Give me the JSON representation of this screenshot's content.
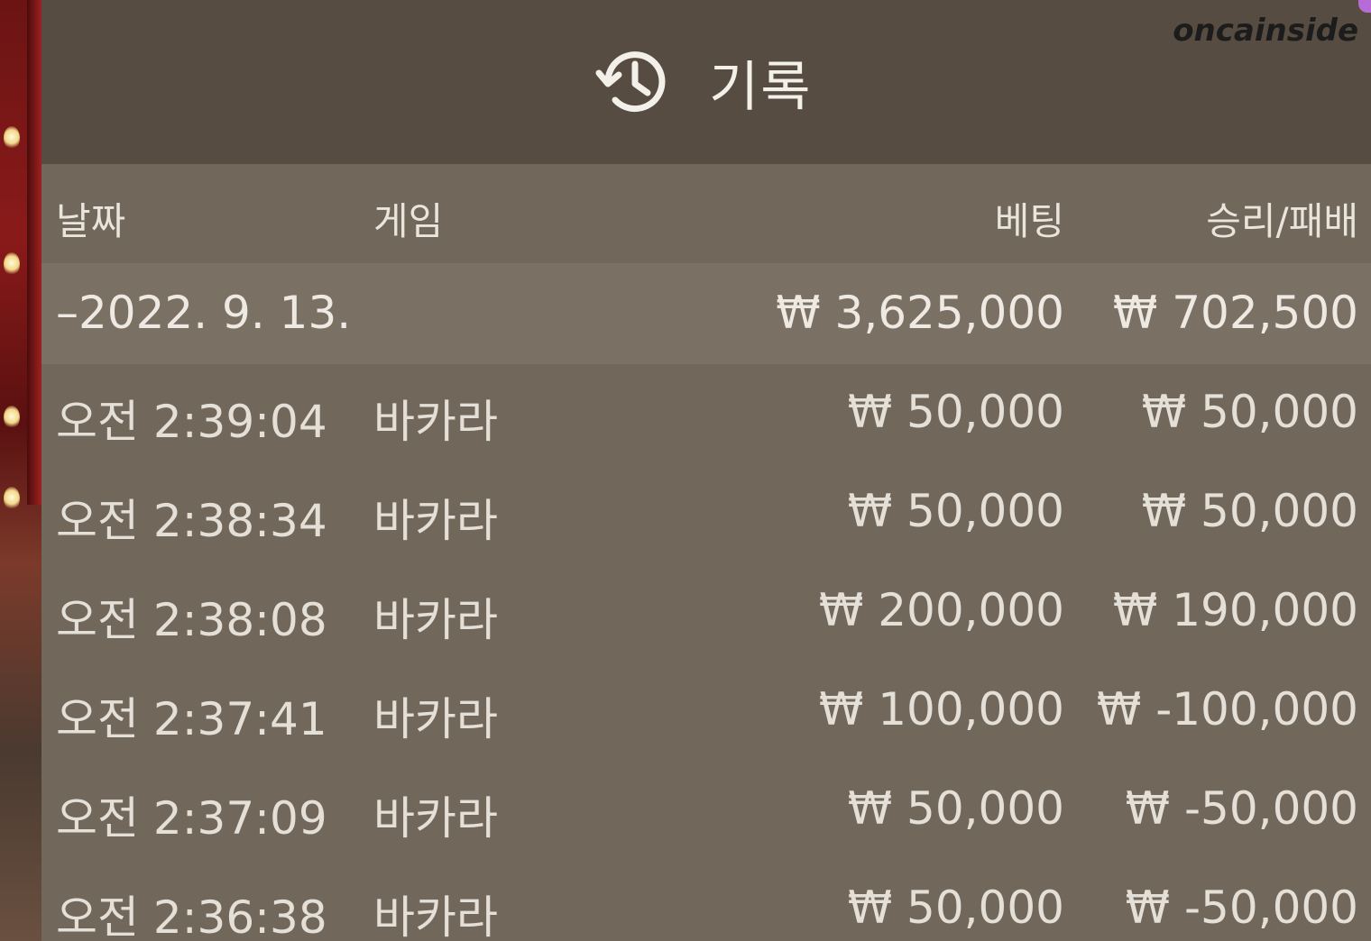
{
  "header": {
    "title": "기록",
    "icon": "history-icon",
    "watermark": "oncainside"
  },
  "table": {
    "columns": {
      "date": "날짜",
      "game": "게임",
      "bet": "베팅",
      "result": "승리/패배"
    },
    "summary": {
      "date": "–2022. 9. 13.",
      "bet": "₩ 3,625,000",
      "result": "₩ 702,500"
    },
    "rows": [
      {
        "time": "오전 2:39:04",
        "game": "바카라",
        "bet": "₩ 50,000",
        "result": "₩ 50,000"
      },
      {
        "time": "오전 2:38:34",
        "game": "바카라",
        "bet": "₩ 50,000",
        "result": "₩ 50,000"
      },
      {
        "time": "오전 2:38:08",
        "game": "바카라",
        "bet": "₩ 200,000",
        "result": "₩ 190,000"
      },
      {
        "time": "오전 2:37:41",
        "game": "바카라",
        "bet": "₩ 100,000",
        "result": "₩ -100,000"
      },
      {
        "time": "오전 2:37:09",
        "game": "바카라",
        "bet": "₩ 50,000",
        "result": "₩ -50,000"
      },
      {
        "time": "오전 2:36:38",
        "game": "바카라",
        "bet": "₩ 50,000",
        "result": "₩ -50,000"
      }
    ]
  }
}
